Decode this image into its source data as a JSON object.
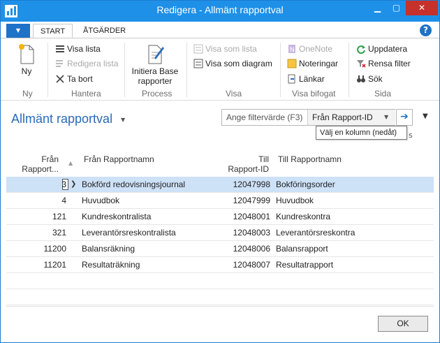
{
  "window": {
    "title": "Redigera - Allmänt rapportval"
  },
  "ribbon": {
    "tabs": [
      {
        "label": "START"
      },
      {
        "label": "ÅTGÄRDER"
      }
    ],
    "new_label": "Ny",
    "hantera": {
      "show_list": "Visa lista",
      "edit_list": "Redigera lista",
      "delete": "Ta bort"
    },
    "process": {
      "init_line1": "Initiera Base",
      "init_line2": "rapporter"
    },
    "visa": {
      "show_as_list": "Visa som lista",
      "show_as_chart": "Visa som diagram"
    },
    "bifogat": {
      "onenote": "OneNote",
      "notes": "Noteringar",
      "links": "Länkar"
    },
    "sida": {
      "refresh": "Uppdatera",
      "clear_filter": "Rensa filter",
      "search": "Sök"
    },
    "group_labels": {
      "ny": "Ny",
      "hantera": "Hantera",
      "process": "Process",
      "visa": "Visa",
      "bifogat": "Visa bifogat",
      "sida": "Sida"
    }
  },
  "page": {
    "title": "Allmänt rapportval",
    "filter_placeholder": "Ange filtervärde (F3)",
    "filter_column": "Från Rapport-ID",
    "tooltip": "Välj en kolumn (nedåt)",
    "tooltip_behind": "s"
  },
  "grid": {
    "headers": {
      "from_id_1": "Från",
      "from_id_2": "Rapport...",
      "from_name": "Från Rapportnamn",
      "to_id_1": "Till",
      "to_id_2": "Rapport-ID",
      "to_name": "Till Rapportnamn"
    },
    "rows": [
      {
        "from_id": "3",
        "from_name": "Bokförd redovisningsjournal",
        "to_id": "12047998",
        "to_name": "Bokföringsorder"
      },
      {
        "from_id": "4",
        "from_name": "Huvudbok",
        "to_id": "12047999",
        "to_name": "Huvudbok"
      },
      {
        "from_id": "121",
        "from_name": "Kundreskontralista",
        "to_id": "12048001",
        "to_name": "Kundreskontra"
      },
      {
        "from_id": "321",
        "from_name": "Leverantörsreskontralista",
        "to_id": "12048003",
        "to_name": "Leverantörsreskontra"
      },
      {
        "from_id": "11200",
        "from_name": "Balansräkning",
        "to_id": "12048006",
        "to_name": "Balansrapport"
      },
      {
        "from_id": "11201",
        "from_name": "Resultaträkning",
        "to_id": "12048007",
        "to_name": "Resultatrapport"
      }
    ]
  },
  "footer": {
    "ok_label": "OK"
  },
  "colors": {
    "accent": "#1e90e8",
    "selection": "#cde1f7",
    "title_blue": "#2a6bb8"
  }
}
